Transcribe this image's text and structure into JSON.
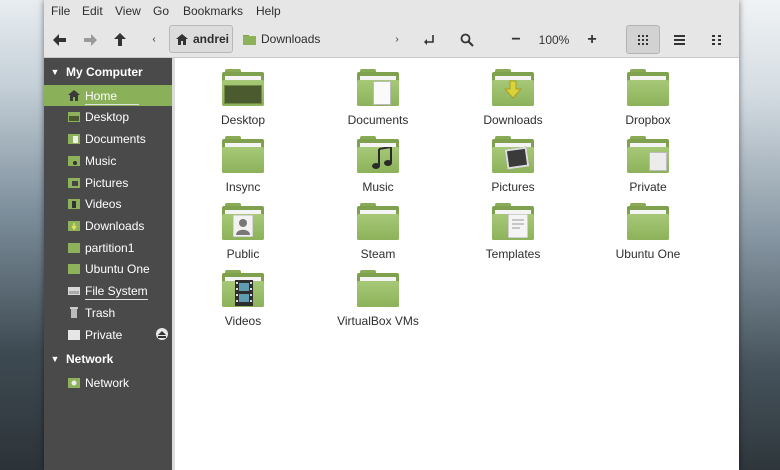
{
  "menu": [
    "File",
    "Edit",
    "View",
    "Go",
    "Bookmarks",
    "Help"
  ],
  "toolbar": {
    "back_icon": "arrow-left-icon",
    "forward_icon": "arrow-right-icon",
    "up_icon": "arrow-up-icon",
    "breadcrumb_home": "andrei",
    "breadcrumb_current": "Downloads",
    "zoom_out": "−",
    "zoom_level": "100%",
    "zoom_in": "+"
  },
  "sidebar": {
    "sections": [
      {
        "title": "My Computer",
        "items": [
          {
            "label": "Home",
            "icon": "home-icon",
            "active": true
          },
          {
            "label": "Desktop",
            "icon": "desktop-icon"
          },
          {
            "label": "Documents",
            "icon": "documents-folder-icon"
          },
          {
            "label": "Music",
            "icon": "music-folder-icon"
          },
          {
            "label": "Pictures",
            "icon": "pictures-folder-icon"
          },
          {
            "label": "Videos",
            "icon": "videos-folder-icon"
          },
          {
            "label": "Downloads",
            "icon": "downloads-folder-icon"
          },
          {
            "label": "partition1",
            "icon": "folder-icon"
          },
          {
            "label": "Ubuntu One",
            "icon": "folder-icon"
          },
          {
            "label": "File System",
            "icon": "drive-icon"
          },
          {
            "label": "Trash",
            "icon": "trash-icon"
          },
          {
            "label": "Private",
            "icon": "private-folder-icon",
            "eject": true
          }
        ]
      },
      {
        "title": "Network",
        "items": [
          {
            "label": "Network",
            "icon": "network-icon"
          }
        ]
      }
    ]
  },
  "folders": [
    {
      "label": "Desktop",
      "emblem": "desktop"
    },
    {
      "label": "Documents",
      "emblem": "document"
    },
    {
      "label": "Downloads",
      "emblem": "download"
    },
    {
      "label": "Dropbox",
      "emblem": "none"
    },
    {
      "label": "Insync",
      "emblem": "none"
    },
    {
      "label": "Music",
      "emblem": "music"
    },
    {
      "label": "Pictures",
      "emblem": "pictures"
    },
    {
      "label": "Private",
      "emblem": "private"
    },
    {
      "label": "Public",
      "emblem": "public"
    },
    {
      "label": "Steam",
      "emblem": "none"
    },
    {
      "label": "Templates",
      "emblem": "template"
    },
    {
      "label": "Ubuntu One",
      "emblem": "none"
    },
    {
      "label": "Videos",
      "emblem": "video"
    },
    {
      "label": "VirtualBox VMs",
      "emblem": "none"
    }
  ],
  "colors": {
    "accent": "#8ab05a",
    "sidebar": "#4a4a4a"
  }
}
